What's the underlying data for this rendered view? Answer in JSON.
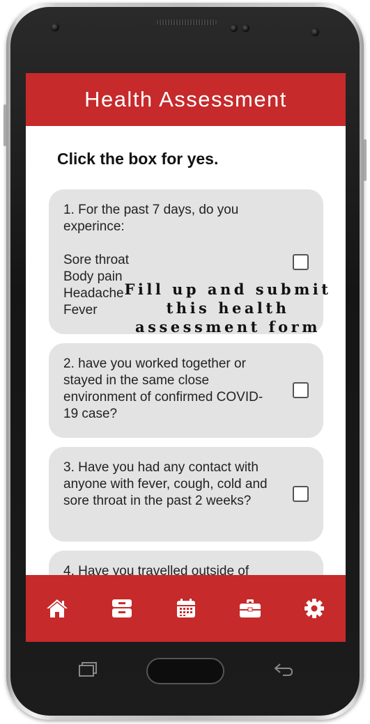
{
  "header": {
    "title": "Health Assessment"
  },
  "instruction": "Click the box for yes.",
  "questions": [
    {
      "text": "1. For the past 7 days, do you experince:",
      "options": [
        "Sore throat",
        "Body pain",
        "Headache",
        "Fever"
      ],
      "checked": false
    },
    {
      "text": "2. have you worked together or stayed in the same close environment of confirmed COVID-19 case?",
      "checked": false
    },
    {
      "text": "3. Have you had any contact with anyone with fever, cough, cold and sore throat in the past 2 weeks?",
      "checked": false
    },
    {
      "text": "4. Have you travelled outside of"
    }
  ],
  "overlay_text": "Fill up and submit this health assessment form",
  "nav": [
    {
      "name": "home",
      "icon": "home-icon"
    },
    {
      "name": "inbox",
      "icon": "inbox-tray-icon"
    },
    {
      "name": "calendar",
      "icon": "calendar-icon"
    },
    {
      "name": "briefcase",
      "icon": "briefcase-icon"
    },
    {
      "name": "settings",
      "icon": "gear-icon"
    }
  ],
  "colors": {
    "brand": "#c62a2b",
    "card": "#e3e3e3"
  }
}
